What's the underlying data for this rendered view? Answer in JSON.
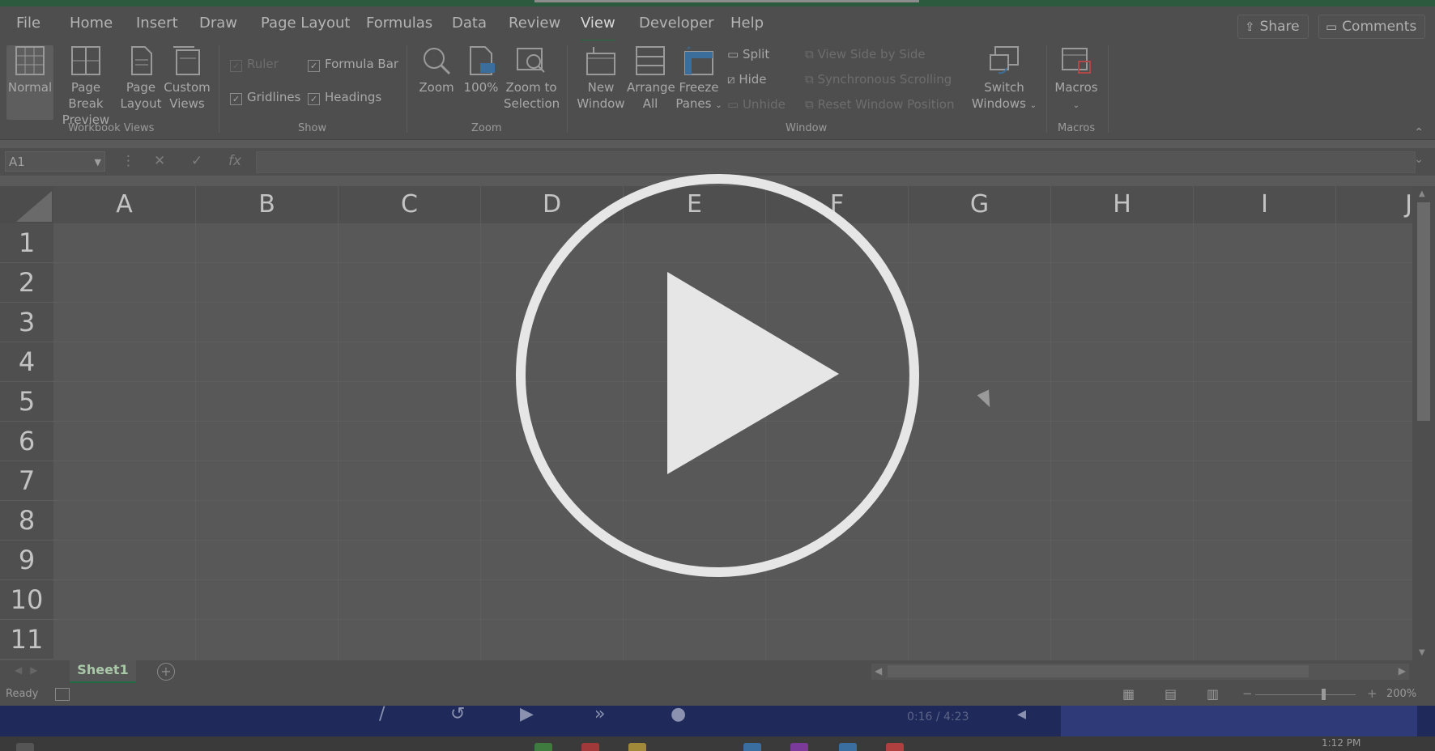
{
  "menu": {
    "tabs": [
      "File",
      "Home",
      "Insert",
      "Draw",
      "Page Layout",
      "Formulas",
      "Data",
      "Review",
      "View",
      "Developer",
      "Help"
    ],
    "active": "View",
    "share": "Share",
    "comments": "Comments"
  },
  "ribbon": {
    "workbook_views": {
      "normal": "Normal",
      "page_break_preview": [
        "Page Break",
        "Preview"
      ],
      "page_layout": [
        "Page",
        "Layout"
      ],
      "custom_views": [
        "Custom",
        "Views"
      ],
      "group": "Workbook Views"
    },
    "show": {
      "ruler": "Ruler",
      "formula_bar": "Formula Bar",
      "gridlines": "Gridlines",
      "headings": "Headings",
      "group": "Show"
    },
    "zoom": {
      "zoom": "Zoom",
      "hundred": "100%",
      "zoom_to_selection": [
        "Zoom to",
        "Selection"
      ],
      "group": "Zoom"
    },
    "window": {
      "new_window": [
        "New",
        "Window"
      ],
      "arrange_all": [
        "Arrange",
        "All"
      ],
      "freeze_panes": [
        "Freeze",
        "Panes"
      ],
      "split": "Split",
      "hide": "Hide",
      "unhide": "Unhide",
      "view_side_by_side": "View Side by Side",
      "synchronous_scrolling": "Synchronous Scrolling",
      "reset_window_position": "Reset Window Position",
      "switch_windows": [
        "Switch",
        "Windows"
      ],
      "group": "Window"
    },
    "macros": {
      "macros": "Macros",
      "group": "Macros"
    }
  },
  "formula_bar": {
    "name_box": "A1",
    "fx": "fx"
  },
  "sheet": {
    "columns": [
      "A",
      "B",
      "C",
      "D",
      "E",
      "F",
      "G",
      "H",
      "I",
      "J"
    ],
    "rows": [
      "1",
      "2",
      "3",
      "4",
      "5",
      "6",
      "7",
      "8",
      "9",
      "10",
      "11"
    ]
  },
  "tabs_bar": {
    "sheet_tab": "Sheet1"
  },
  "status": {
    "ready": "Ready",
    "zoom": "200%"
  },
  "media": {
    "time": "0:16 / 4:23"
  },
  "taskbar": {
    "clock": "1:12 PM"
  },
  "overlay": {
    "play_icon": "play-icon"
  }
}
